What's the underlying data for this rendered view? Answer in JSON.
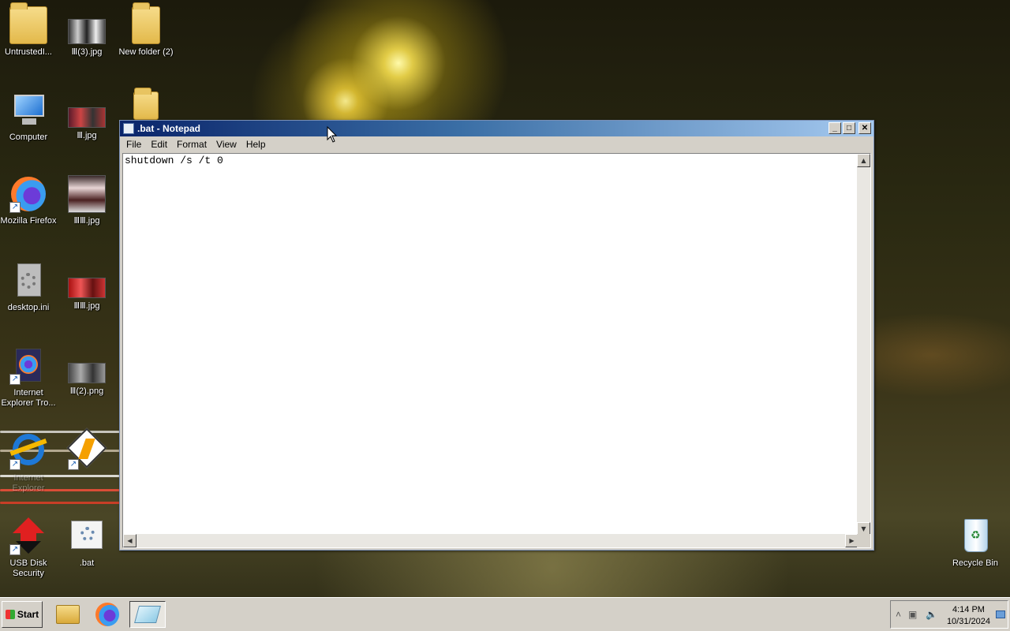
{
  "desktop": {
    "icons": [
      {
        "label": "UntrustedI...",
        "icon": "folder-user-icon"
      },
      {
        "label": "Ⅲ(3).jpg",
        "icon": "image-icon"
      },
      {
        "label": "New folder (2)",
        "icon": "folder-icon"
      },
      {
        "label": "Computer",
        "icon": "computer-icon"
      },
      {
        "label": "Ⅲ.jpg",
        "icon": "image-icon"
      },
      {
        "label": "Mozilla Firefox",
        "icon": "firefox-icon"
      },
      {
        "label": "ⅢⅢ.jpg",
        "icon": "image-icon"
      },
      {
        "label": "desktop.ini",
        "icon": "settings-file-icon"
      },
      {
        "label": "ⅢⅢ.jpg",
        "icon": "image-icon"
      },
      {
        "label": "Internet Explorer Tro...",
        "icon": "firefox-icon"
      },
      {
        "label": "Ⅲ(2).png",
        "icon": "image-icon"
      },
      {
        "label": "Internet Explorer",
        "icon": "ie-icon"
      },
      {
        "label": "",
        "icon": "winamp-icon"
      },
      {
        "label": "USB Disk Security",
        "icon": "usb-security-icon"
      },
      {
        "label": ".bat",
        "icon": "batch-file-icon"
      },
      {
        "label": "Recycle Bin",
        "icon": "recycle-bin-icon"
      }
    ]
  },
  "notepad": {
    "title": ".bat - Notepad",
    "menu": [
      "File",
      "Edit",
      "Format",
      "View",
      "Help"
    ],
    "content": "shutdown /s /t 0",
    "buttons": {
      "minimize": "_",
      "maximize": "□",
      "close": "✕"
    }
  },
  "taskbar": {
    "start_label": "Start",
    "quick_launch": [
      "explorer-icon",
      "firefox-icon",
      "notepad-icon"
    ],
    "clock_time": "4:14 PM",
    "clock_date": "10/31/2024"
  },
  "colors": {
    "titlebar_start": "#0a246a",
    "titlebar_end": "#a6caf0",
    "taskbar": "#d4d0c8"
  }
}
